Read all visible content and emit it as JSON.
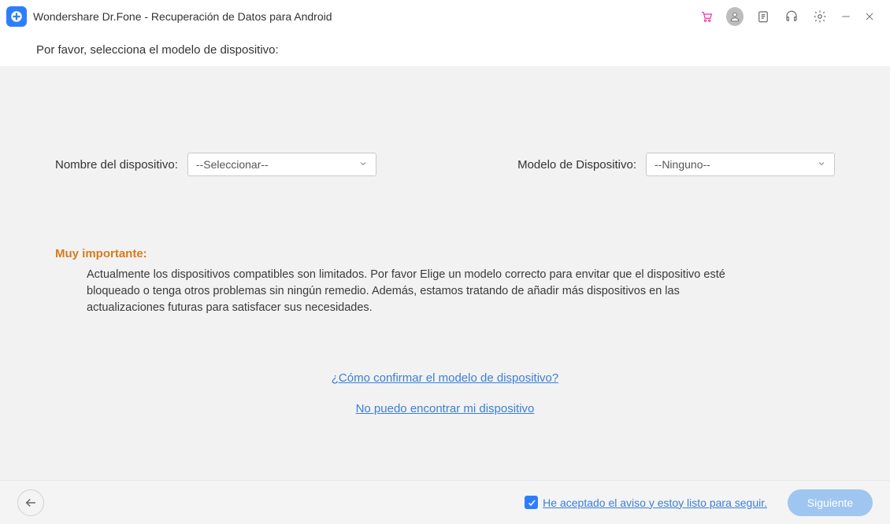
{
  "titlebar": {
    "app_title": "Wondershare Dr.Fone - Recuperación de Datos para Android"
  },
  "instruction": "Por favor, selecciona el modelo de dispositivo:",
  "selects": {
    "device_name_label": "Nombre del dispositivo:",
    "device_name_value": "--Seleccionar--",
    "device_model_label": "Modelo de Dispositivo:",
    "device_model_value": "--Ninguno--"
  },
  "important": {
    "heading": "Muy importante:",
    "body": "Actualmente los dispositivos compatibles son limitados. Por favor Elige un modelo correcto para envitar que el dispositivo esté bloqueado o tenga otros problemas sin ningún remedio. Además, estamos tratando de añadir más dispositivos en las actualizaciones futuras para satisfacer sus necesidades."
  },
  "links": {
    "confirm_model": "¿Cómo confirmar el modelo de dispositivo?",
    "cannot_find": "No puedo encontrar mi dispositivo"
  },
  "footer": {
    "accept_label": "He aceptado el aviso y estoy listo para seguir.",
    "next_label": "Siguiente"
  }
}
